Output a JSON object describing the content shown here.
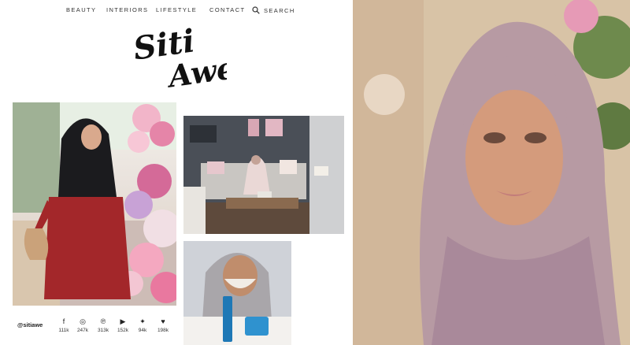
{
  "nav": {
    "items": [
      "BEAUTY",
      "INTERIORS",
      "LIFESTYLE",
      "CONTACT"
    ],
    "search_label": "SEARCH"
  },
  "logo": {
    "line1": "Siti",
    "line2": "Awe"
  },
  "social": {
    "handle": "@sitiawe",
    "items": [
      {
        "icon": "facebook-icon",
        "count": "111k"
      },
      {
        "icon": "instagram-icon",
        "count": "247k"
      },
      {
        "icon": "pinterest-icon",
        "count": "313k"
      },
      {
        "icon": "youtube-icon",
        "count": "152k"
      },
      {
        "icon": "twitter-icon",
        "count": "94k"
      },
      {
        "icon": "heart-icon",
        "count": "198k"
      }
    ]
  },
  "colors": {
    "hijab_black": "#1b1b1e",
    "dress_red": "#a3272a",
    "hijab_mauve": "#b79aa3",
    "flowers_pink": "#e89ab8",
    "sofa_grey": "#c9c6c2"
  }
}
